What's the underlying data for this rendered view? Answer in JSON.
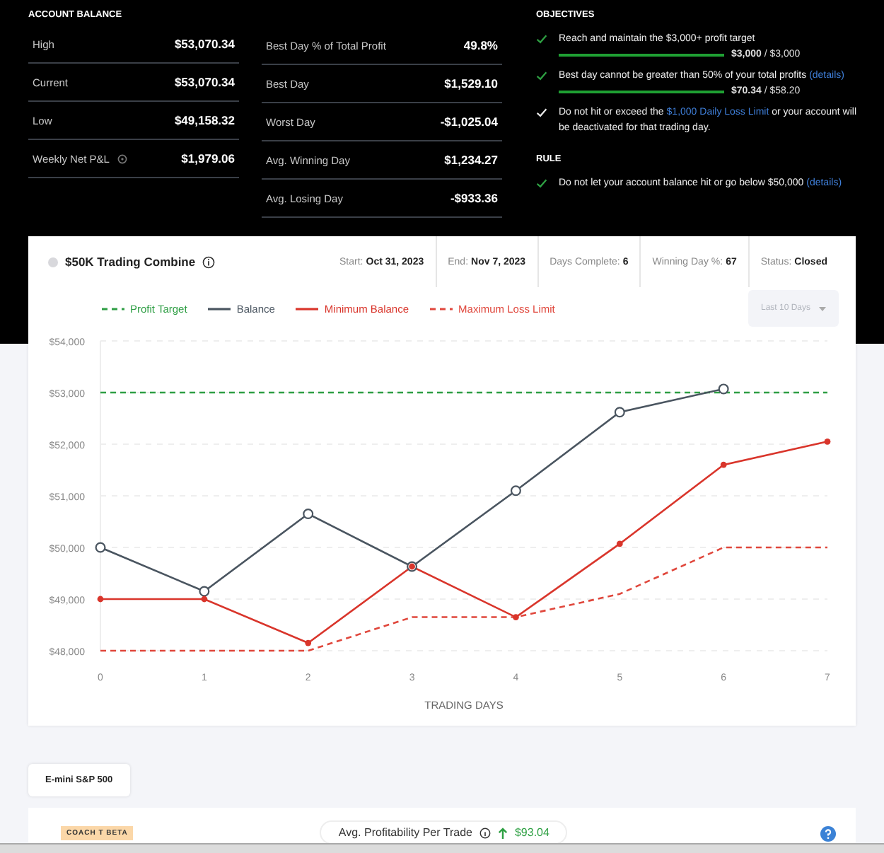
{
  "account_balance": {
    "title": "ACCOUNT BALANCE",
    "rows": [
      {
        "label": "High",
        "value": "$53,070.34",
        "info": false
      },
      {
        "label": "Current",
        "value": "$53,070.34",
        "info": false
      },
      {
        "label": "Low",
        "value": "$49,158.32",
        "info": false
      },
      {
        "label": "Weekly Net P&L",
        "value": "$1,979.06",
        "info": true
      }
    ]
  },
  "day_stats": [
    {
      "label": "Best Day % of Total Profit",
      "value": "49.8%"
    },
    {
      "label": "Best Day",
      "value": "$1,529.10"
    },
    {
      "label": "Worst Day",
      "value": "-$1,025.04"
    },
    {
      "label": "Avg. Winning Day",
      "value": "$1,234.27"
    },
    {
      "label": "Avg. Losing Day",
      "value": "-$933.36"
    }
  ],
  "objectives": {
    "title": "OBJECTIVES",
    "items": [
      {
        "met": true,
        "text": "Reach and maintain the $3,000+ profit target",
        "progress": {
          "level": 1,
          "reading": "**$3,000** / $3,000"
        }
      },
      {
        "met": true,
        "text": "Best day cannot be greater than 50% of your total profits ",
        "link": "(details)",
        "progress": {
          "level": 1,
          "reading": "**$70.34** / $58.20"
        }
      },
      {
        "met": false,
        "text": "Do not hit or exceed the ",
        "link": "$1,000 Daily Loss Limit",
        "text_after": " or your account will be deactivated for that trading day."
      }
    ]
  },
  "rule": {
    "title": "RULE",
    "items": [
      {
        "met": true,
        "text": "Do not let your account balance hit or go below $50,000 ",
        "link": "(details)"
      }
    ]
  },
  "combine": {
    "title": "$50K Trading Combine",
    "stats": [
      {
        "label": "Start:",
        "value": "Oct 31, 2023"
      },
      {
        "label": "End:",
        "value": "Nov 7, 2023"
      },
      {
        "label": "Days Complete:",
        "value": "6"
      },
      {
        "label": "Winning Day %:",
        "value": "67"
      },
      {
        "label": "Status:",
        "value": "Closed"
      }
    ],
    "range": {
      "value": "Last 10 Days",
      "disabled": true
    },
    "chart_data": {
      "type": "line",
      "grid": true,
      "xlabel": "TRADING DAYS",
      "x": [
        0,
        1,
        2,
        3,
        4,
        5,
        6,
        7
      ],
      "xlim": [
        0,
        7
      ],
      "ylim": [
        48000,
        54000
      ],
      "xticks": [
        0,
        1,
        2,
        3,
        4,
        5,
        6,
        7
      ],
      "yticks": [
        {
          "value": 48000,
          "label": "$48,000"
        },
        {
          "value": 49000,
          "label": "$49,000"
        },
        {
          "value": 50000,
          "label": "$50,000"
        },
        {
          "value": 51000,
          "label": "$51,000"
        },
        {
          "value": 52000,
          "label": "$52,000"
        },
        {
          "value": 53000,
          "label": "$53,000"
        },
        {
          "value": 54000,
          "label": "$54,000"
        }
      ],
      "series": [
        {
          "name": "Profit Target",
          "color": "#2e9e44",
          "line_style": "dashed",
          "marker": "none",
          "values": [
            53000,
            53000,
            53000,
            53000,
            53000,
            53000,
            53000,
            53000
          ]
        },
        {
          "name": "Balance",
          "color": "#4a5560",
          "line_style": "solid",
          "marker": "hollow-circle",
          "values": [
            50000,
            49150,
            50650,
            49630,
            51100,
            52620,
            53070,
            null
          ]
        },
        {
          "name": "Minimum Balance",
          "color": "#d9352b",
          "line_style": "solid",
          "marker": "circle",
          "values": [
            49000,
            49000,
            48150,
            49630,
            48650,
            50070,
            51600,
            52050
          ]
        },
        {
          "name": "Maximum Loss Limit",
          "color": "#e0473c",
          "line_style": "dashed",
          "marker": "none",
          "values": [
            48000,
            48000,
            48000,
            48650,
            48650,
            49100,
            50000,
            50000
          ]
        }
      ]
    }
  },
  "instrument_tab": {
    "label": "E-mini S&P 500",
    "selected": true
  },
  "coach": {
    "badge": "COACH T BETA",
    "metric_label": "Avg. Profitability Per Trade",
    "metric_value": "$93.04"
  }
}
